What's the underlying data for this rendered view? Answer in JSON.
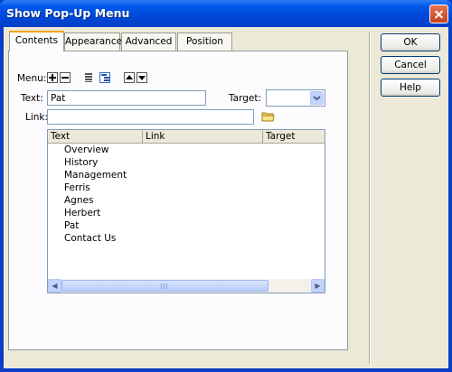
{
  "window": {
    "title": "Show Pop-Up Menu"
  },
  "tabs": [
    {
      "label": "Contents"
    },
    {
      "label": "Appearance"
    },
    {
      "label": "Advanced"
    },
    {
      "label": "Position"
    }
  ],
  "form": {
    "menu_label": "Menu:",
    "text_label": "Text:",
    "text_value": "Pat",
    "target_label": "Target:",
    "target_value": "",
    "link_label": "Link:",
    "link_value": ""
  },
  "list": {
    "columns": [
      "Text",
      "Link",
      "Target"
    ],
    "items": [
      "Overview",
      "History",
      "Management",
      "Ferris",
      "Agnes",
      "Herbert",
      "Pat",
      "Contact Us"
    ]
  },
  "buttons": {
    "ok": "OK",
    "cancel": "Cancel",
    "help": "Help"
  }
}
